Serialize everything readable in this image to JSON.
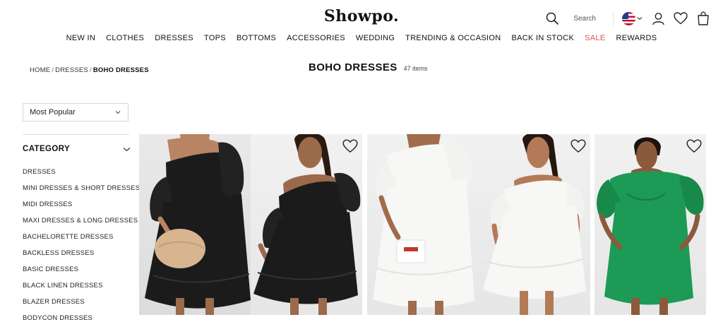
{
  "brand": {
    "logo_text": "Showpo."
  },
  "header": {
    "search_label": "Search",
    "icons": [
      "search-icon",
      "us-flag-icon",
      "chevron-down-icon",
      "user-icon",
      "heart-icon",
      "shopping-bag-icon"
    ]
  },
  "nav": {
    "items": [
      {
        "label": "NEW IN"
      },
      {
        "label": "CLOTHES"
      },
      {
        "label": "DRESSES"
      },
      {
        "label": "TOPS"
      },
      {
        "label": "BOTTOMS"
      },
      {
        "label": "ACCESSORIES"
      },
      {
        "label": "WEDDING"
      },
      {
        "label": "TRENDING & OCCASION"
      },
      {
        "label": "BACK IN STOCK"
      },
      {
        "label": "SALE"
      },
      {
        "label": "REWARDS"
      }
    ],
    "sale_color": "#d9534f"
  },
  "breadcrumb": {
    "home": "HOME",
    "parent": "DRESSES",
    "current": "BOHO DRESSES",
    "separator": "/"
  },
  "page": {
    "title": "BOHO DRESSES",
    "count": "47 items"
  },
  "sort": {
    "selected": "Most Popular"
  },
  "category": {
    "title": "CATEGORY",
    "items": [
      "DRESSES",
      "MINI DRESSES & SHORT DRESSES",
      "MIDI DRESSES",
      "MAXI DRESSES & LONG DRESSES",
      "BACHELORETTE DRESSES",
      "BACKLESS DRESSES",
      "BASIC DRESSES",
      "BLACK LINEN DRESSES",
      "BLAZER DRESSES",
      "BODYCON DRESSES"
    ]
  },
  "products": [
    {
      "dress_color": "#1b1b1b",
      "skin": "#b88462",
      "skin_alt": "#9a6a4b",
      "hair": "#2a1a12",
      "accessory": "clutch-bag"
    },
    {
      "dress_color": "#f7f7f5",
      "skin": "#a06c4c",
      "skin_alt": "#b37a58",
      "hair": "#241710",
      "accessory": "mini-bag"
    },
    {
      "dress_color": "#1d9a55",
      "skin": "#8b5a3c",
      "hair": "#1d120c",
      "accessory": "none"
    }
  ]
}
